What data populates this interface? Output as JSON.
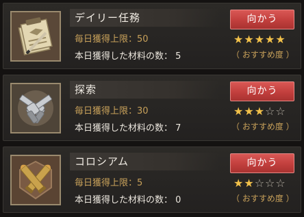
{
  "missions": [
    {
      "title": "デイリー任務",
      "limit_text": "毎日獲得上限：50",
      "count_text": "本日獲得した材料の数： 5",
      "button_label": "向かう",
      "stars_filled": 5,
      "stars_total": 5,
      "recommend_label": "（ おすすめ度 ）",
      "icon": "document-pen-icon"
    },
    {
      "title": "探索",
      "limit_text": "毎日獲得上限：30",
      "count_text": "本日獲得した材料の数： 7",
      "button_label": "向かう",
      "stars_filled": 3,
      "stars_total": 5,
      "recommend_label": "（ おすすめ度 ）",
      "icon": "crossed-revolvers-icon"
    },
    {
      "title": "コロシアム",
      "limit_text": "毎日獲得上限：5",
      "count_text": "本日獲得した材料の数： 0",
      "button_label": "向かう",
      "stars_filled": 2,
      "stars_total": 5,
      "recommend_label": "（ おすすめ度 ）",
      "icon": "crossed-bullets-icon"
    }
  ],
  "colors": {
    "button": "#c94341",
    "gold_text": "#c8a15a",
    "star_filled": "#f2c14a",
    "star_empty": "#b9b2a6"
  }
}
